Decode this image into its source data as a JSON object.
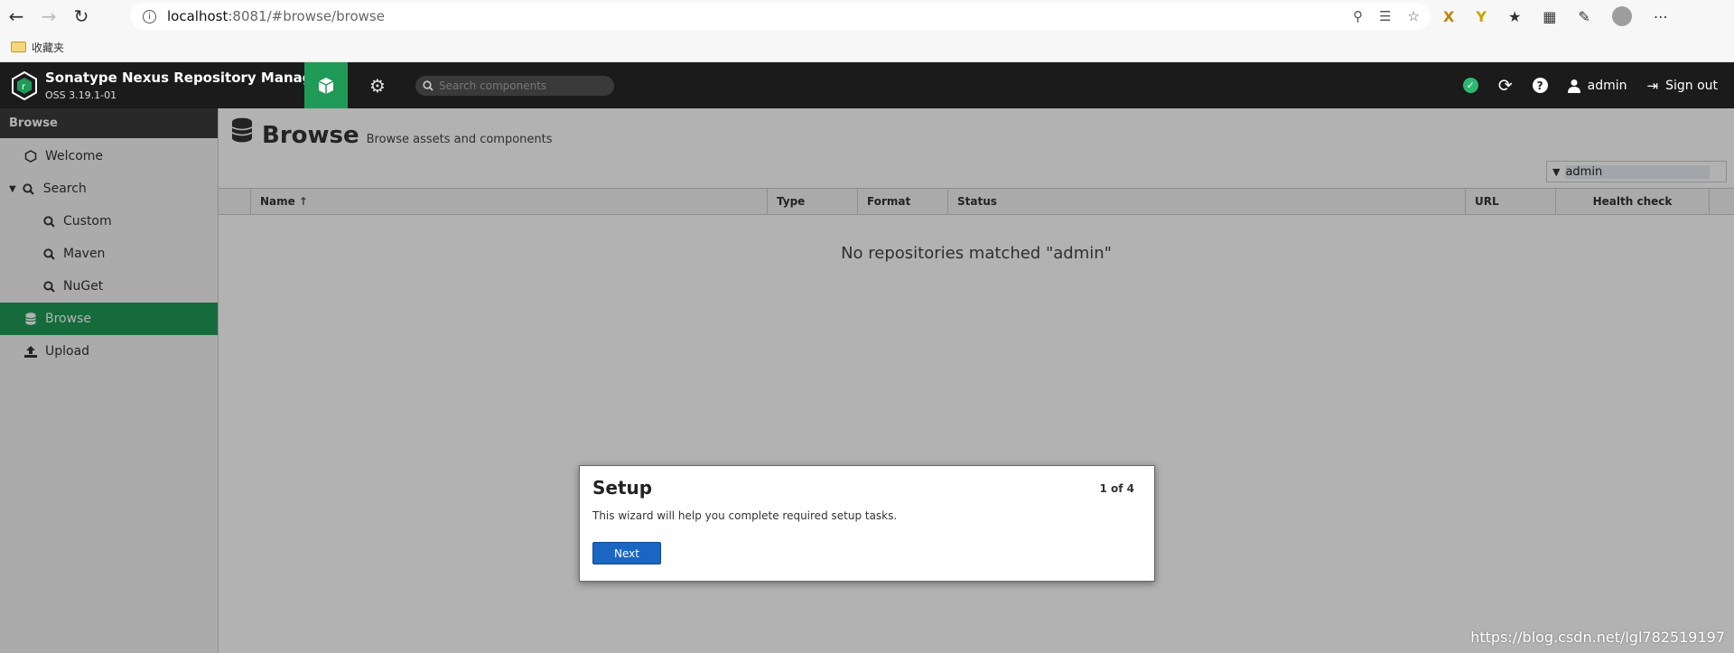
{
  "browser": {
    "url_host": "localhost",
    "url_path": ":8081/#browse/browse",
    "bookmark_folder": "收藏夹"
  },
  "header": {
    "title": "Sonatype Nexus Repository Manager",
    "version": "OSS 3.19.1-01",
    "search_placeholder": "Search components",
    "user": "admin",
    "sign_out": "Sign out",
    "status_color": "#2eb872"
  },
  "sidebar": {
    "section": "Browse",
    "items": [
      {
        "label": "Welcome"
      },
      {
        "label": "Search"
      },
      {
        "label": "Custom"
      },
      {
        "label": "Maven"
      },
      {
        "label": "NuGet"
      },
      {
        "label": "Browse"
      },
      {
        "label": "Upload"
      }
    ]
  },
  "main": {
    "title": "Browse",
    "subtitle": "Browse assets and components",
    "filter_value": "admin",
    "columns": [
      "Name",
      "Type",
      "Format",
      "Status",
      "URL",
      "Health check"
    ],
    "empty_message": "No repositories matched \"admin\""
  },
  "dialog": {
    "title": "Setup",
    "step": "1 of 4",
    "text": "This wizard will help you complete required setup tasks.",
    "next": "Next"
  },
  "watermark": "https://blog.csdn.net/lgl782519197",
  "colors": {
    "accent": "#1f9a57",
    "header_bg": "#1b1b1b",
    "primary_button": "#1a66c2"
  }
}
